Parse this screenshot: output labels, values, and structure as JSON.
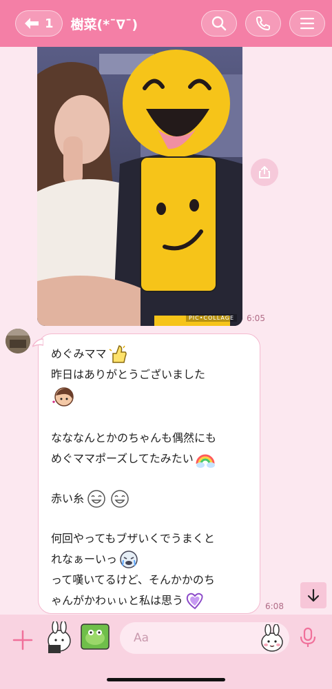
{
  "header": {
    "unread_count": "1",
    "title": "樹菜(*ˉ∇ˉ)",
    "background": "#f47fa6"
  },
  "photo_message": {
    "watermark": "PIC•COLLAGE",
    "time": "6:05"
  },
  "incoming_message": {
    "lines": [
      "めぐみママ",
      "昨日はありがとうございました",
      "",
      "",
      "なななんとかのちゃんも偶然にも",
      "めぐママポーズしてたみたい",
      "",
      "赤い糸",
      "",
      "何回やってもブザいくでうまくと",
      "れなぁーいっ",
      "って嘆いてるけど、そんかかのち",
      "ゃんがかわぃぃと私は思う"
    ],
    "time": "6:08"
  },
  "input": {
    "placeholder": "Aa"
  },
  "icons": {
    "back": "arrow-left-icon",
    "search": "search-icon",
    "call": "phone-icon",
    "menu": "menu-icon",
    "share": "share-icon",
    "scroll": "arrow-down-icon",
    "plus": "plus-icon",
    "mic": "mic-icon"
  }
}
